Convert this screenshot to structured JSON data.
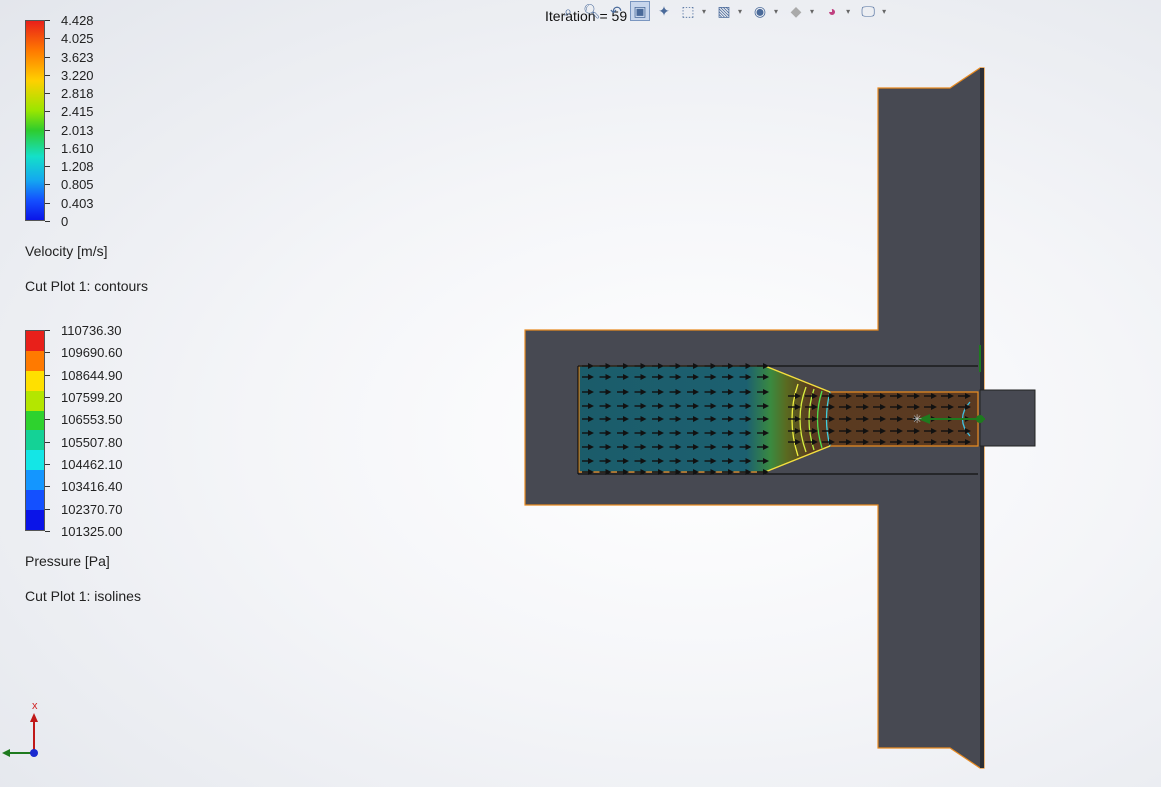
{
  "toolbar": {
    "iteration_label": "Iteration = 59",
    "icons": [
      "zoom-fit-icon",
      "zoom-area-icon",
      "previous-view-icon",
      "section-view-icon",
      "dynamic-annotation-icon",
      "view-orientation-icon",
      "display-style-icon",
      "hide-show-icon",
      "edit-appearance-icon",
      "apply-scene-icon",
      "view-settings-icon"
    ]
  },
  "velocity_legend": {
    "ticks": [
      "4.428",
      "4.025",
      "3.623",
      "3.220",
      "2.818",
      "2.415",
      "2.013",
      "1.610",
      "1.208",
      "0.805",
      "0.403",
      "0"
    ],
    "title": "Velocity [m/s]",
    "plot_label": "Cut Plot 1: contours"
  },
  "pressure_legend": {
    "ticks": [
      "110736.30",
      "109690.60",
      "108644.90",
      "107599.20",
      "106553.50",
      "105507.80",
      "104462.10",
      "103416.40",
      "102370.70",
      "101325.00"
    ],
    "colors": [
      "#e8201a",
      "#ff7a00",
      "#ffe000",
      "#b4e600",
      "#2ed22e",
      "#14d296",
      "#14e6e6",
      "#1496ff",
      "#1450ff",
      "#0a14e8"
    ],
    "title": "Pressure [Pa]",
    "plot_label": "Cut Plot 1: isolines"
  },
  "triad": {
    "x_label": "x"
  }
}
